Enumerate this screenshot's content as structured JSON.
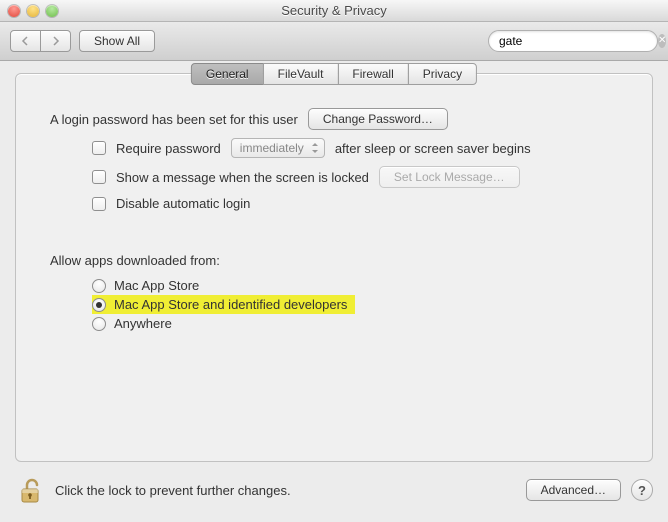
{
  "window": {
    "title": "Security & Privacy"
  },
  "toolbar": {
    "show_all": "Show All",
    "search": {
      "value": "gate"
    }
  },
  "tabs": [
    {
      "label": "General"
    },
    {
      "label": "FileVault"
    },
    {
      "label": "Firewall"
    },
    {
      "label": "Privacy"
    }
  ],
  "content": {
    "login_text": "A login password has been set for this user",
    "change_password": "Change Password…",
    "require_password_label": "Require password",
    "require_password_select": "immediately",
    "require_password_after": "after sleep or screen saver begins",
    "show_message": "Show a message when the screen is locked",
    "set_lock_message": "Set Lock Message…",
    "disable_auto_login": "Disable automatic login",
    "gatekeeper_heading": "Allow apps downloaded from:",
    "radio": [
      "Mac App Store",
      "Mac App Store and identified developers",
      "Anywhere"
    ]
  },
  "footer": {
    "lock_text": "Click the lock to prevent further changes.",
    "advanced": "Advanced…",
    "help": "?"
  }
}
